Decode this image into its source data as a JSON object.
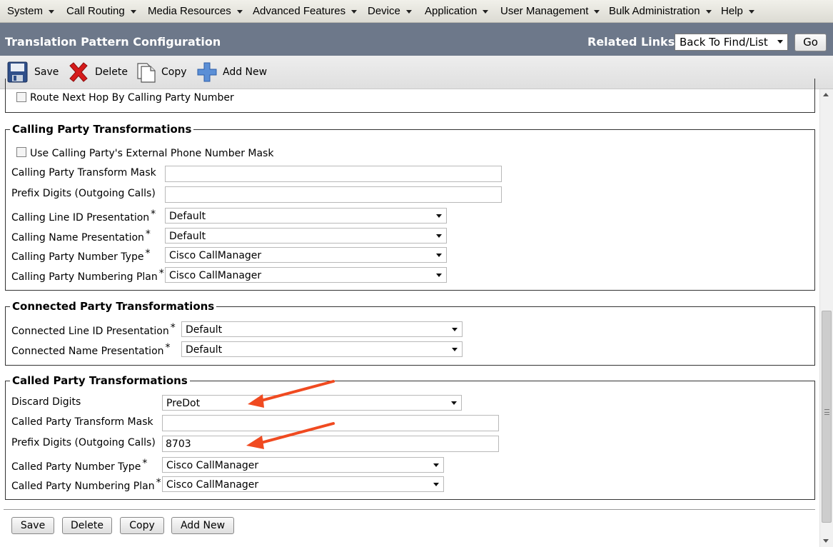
{
  "menu": [
    "System",
    "Call Routing",
    "Media Resources",
    "Advanced Features",
    "Device",
    "Application",
    "User Management",
    "Bulk Administration",
    "Help"
  ],
  "header": {
    "title": "Translation Pattern Configuration",
    "related_links_label": "Related Links:",
    "related_links_value": "Back To Find/List",
    "go_label": "Go"
  },
  "toolbar": {
    "save": "Save",
    "delete": "Delete",
    "copy": "Copy",
    "add_new": "Add New"
  },
  "top_section": {
    "route_next_hop_label": "Route Next Hop By Calling Party Number",
    "route_next_hop_checked": false
  },
  "calling_party": {
    "legend": "Calling Party Transformations",
    "use_external_mask_label": "Use Calling Party's External Phone Number Mask",
    "use_external_mask_checked": false,
    "transform_mask_label": "Calling Party Transform Mask",
    "transform_mask_value": "",
    "prefix_digits_label": "Prefix Digits (Outgoing Calls)",
    "prefix_digits_value": "",
    "line_id_presentation_label": "Calling Line ID Presentation",
    "line_id_presentation_value": "Default",
    "name_presentation_label": "Calling Name Presentation",
    "name_presentation_value": "Default",
    "number_type_label": "Calling Party Number Type",
    "number_type_value": "Cisco CallManager",
    "numbering_plan_label": "Calling Party Numbering Plan",
    "numbering_plan_value": "Cisco CallManager"
  },
  "connected_party": {
    "legend": "Connected Party Transformations",
    "line_id_presentation_label": "Connected Line ID Presentation",
    "line_id_presentation_value": "Default",
    "name_presentation_label": "Connected Name Presentation",
    "name_presentation_value": "Default"
  },
  "called_party": {
    "legend": "Called Party Transformations",
    "discard_digits_label": "Discard Digits",
    "discard_digits_value": "PreDot",
    "transform_mask_label": "Called Party Transform Mask",
    "transform_mask_value": "",
    "prefix_digits_label": "Prefix Digits (Outgoing Calls)",
    "prefix_digits_value": "8703",
    "number_type_label": "Called Party Number Type",
    "number_type_value": "Cisco CallManager",
    "numbering_plan_label": "Called Party Numbering Plan",
    "numbering_plan_value": "Cisco CallManager"
  },
  "required_marker": "*",
  "bottom_buttons": {
    "save": "Save",
    "delete": "Delete",
    "copy": "Copy",
    "add_new": "Add New"
  },
  "colors": {
    "title_bar": "#6d788a",
    "annotation_arrow": "#f04a20"
  },
  "icons": [
    "save-icon",
    "delete-icon",
    "copy-icon",
    "add-new-icon",
    "chevron-down-icon"
  ]
}
